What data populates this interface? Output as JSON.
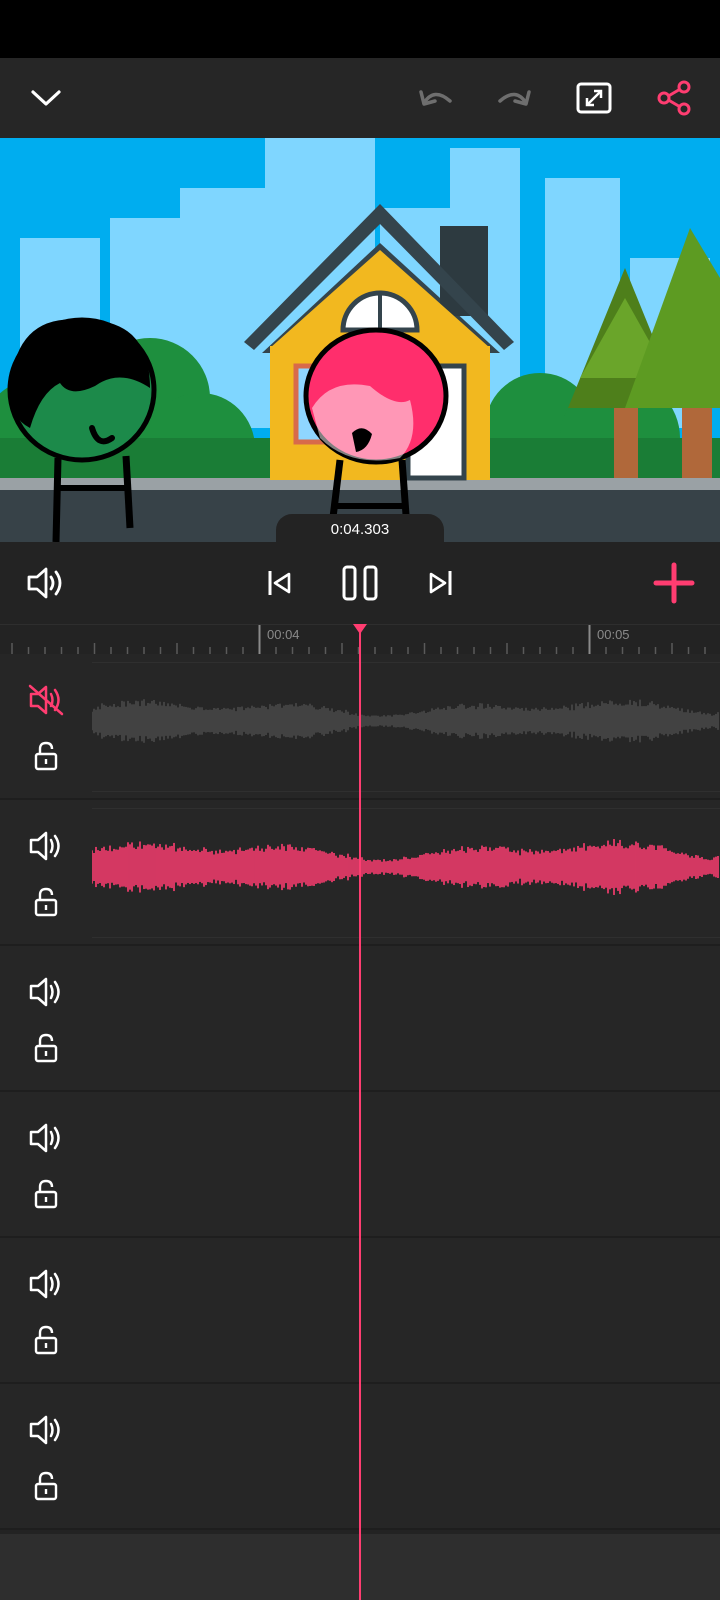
{
  "toolbar": {
    "collapse_icon": "chevron-down-icon",
    "undo_icon": "undo-icon",
    "redo_icon": "redo-icon",
    "fullscreen_icon": "fullscreen-icon",
    "share_icon": "share-icon"
  },
  "preview": {
    "current_time": "0:04.303"
  },
  "controls": {
    "volume_icon": "volume-icon",
    "prev_icon": "skip-to-start-icon",
    "pause_icon": "pause-icon",
    "next_icon": "skip-to-end-icon",
    "add_icon": "add-icon"
  },
  "ruler": {
    "labels": [
      "00:04",
      "00:05"
    ]
  },
  "tracks": [
    {
      "muted": true,
      "locked": false,
      "waveform": "gray"
    },
    {
      "muted": false,
      "locked": false,
      "waveform": "pink"
    },
    {
      "muted": false,
      "locked": false,
      "waveform": "none"
    },
    {
      "muted": false,
      "locked": false,
      "waveform": "none"
    },
    {
      "muted": false,
      "locked": false,
      "waveform": "none"
    },
    {
      "muted": false,
      "locked": false,
      "waveform": "none"
    }
  ],
  "colors": {
    "accent": "#ff3d71",
    "background": "#232323",
    "waveform_gray": "#4a4a4a",
    "icon": "#ffffff",
    "disabled": "#8a8a8a"
  }
}
